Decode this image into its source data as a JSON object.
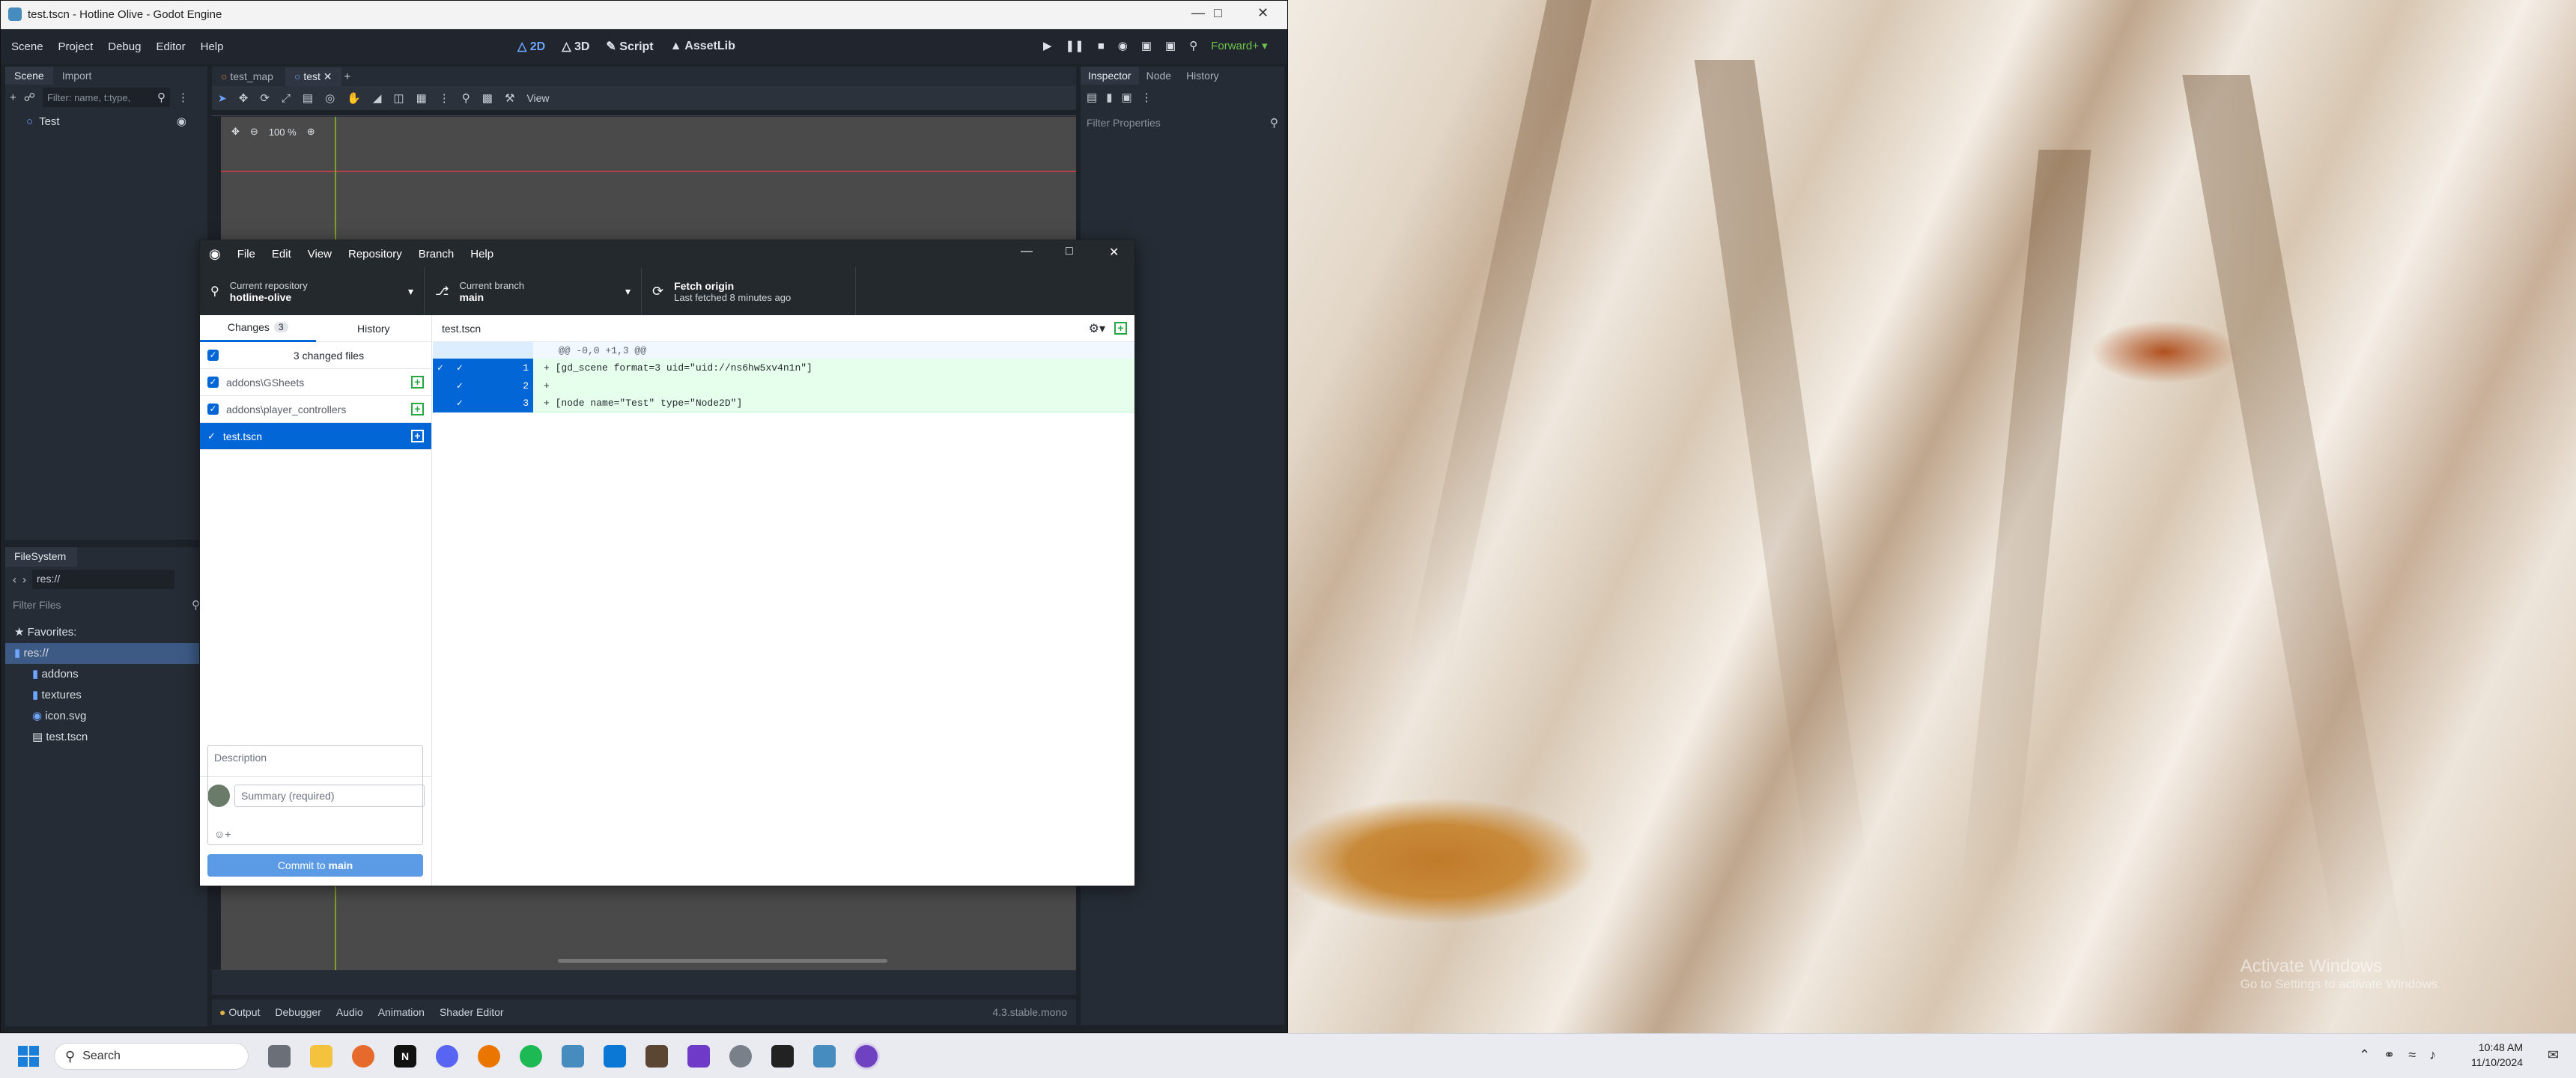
{
  "wallpaper": {
    "watermark_title": "Activate Windows",
    "watermark_sub": "Go to Settings to activate Windows."
  },
  "godot": {
    "title": "test.tscn - Hotline Olive - Godot Engine",
    "menu": [
      "Scene",
      "Project",
      "Debug",
      "Editor",
      "Help"
    ],
    "workspaces": [
      "2D",
      "3D",
      "Script",
      "AssetLib"
    ],
    "renderer": "Forward+",
    "scene_tabs": [
      "Scene",
      "Import"
    ],
    "filter_placeholder": "Filter: name, t:type,",
    "scene_tree_root": "Test",
    "doc_tabs": [
      "test_map",
      "test"
    ],
    "view_label": "View",
    "zoom": "100 %",
    "inspector_tabs": [
      "Inspector",
      "Node",
      "History"
    ],
    "filter_properties": "Filter Properties",
    "filesystem_title": "FileSystem",
    "fs_path": "res://",
    "filter_files": "Filter Files",
    "fs_items": [
      "Favorites:",
      "res://",
      "addons",
      "textures",
      "icon.svg",
      "test.tscn"
    ],
    "bottom_tabs": [
      "Output",
      "Debugger",
      "Audio",
      "Animation",
      "Shader Editor"
    ],
    "version": "4.3.stable.mono"
  },
  "gh": {
    "menu": [
      "File",
      "Edit",
      "View",
      "Repository",
      "Branch",
      "Help"
    ],
    "repo_label": "Current repository",
    "repo_value": "hotline-olive",
    "branch_label": "Current branch",
    "branch_value": "main",
    "fetch_label": "Fetch origin",
    "fetch_sub": "Last fetched 8 minutes ago",
    "tab_changes": "Changes",
    "tab_changes_count": "3",
    "tab_history": "History",
    "changed_files": "3 changed files",
    "files": [
      "addons\\GSheets",
      "addons\\player_controllers",
      "test.tscn"
    ],
    "diff_file": "test.tscn",
    "hunk": "@@ -0,0 +1,3 @@",
    "diff_lines": [
      {
        "n": "1",
        "text": "+  [gd_scene format=3 uid=\"uid://ns6hw5xv4n1n\"]"
      },
      {
        "n": "2",
        "text": "+"
      },
      {
        "n": "3",
        "text": "+  [node name=\"Test\" type=\"Node2D\"]"
      }
    ],
    "summary_placeholder": "Summary (required)",
    "description_placeholder": "Description",
    "commit_prefix": "Commit to ",
    "commit_branch": "main"
  },
  "taskbar": {
    "search": "Search",
    "time": "10:48 AM",
    "date": "11/10/2024"
  },
  "colors": {
    "gh_blue": "#0366d6",
    "gh_green": "#28a745",
    "godot_bg": "#1d2229",
    "accent": "#6ea5ff"
  }
}
